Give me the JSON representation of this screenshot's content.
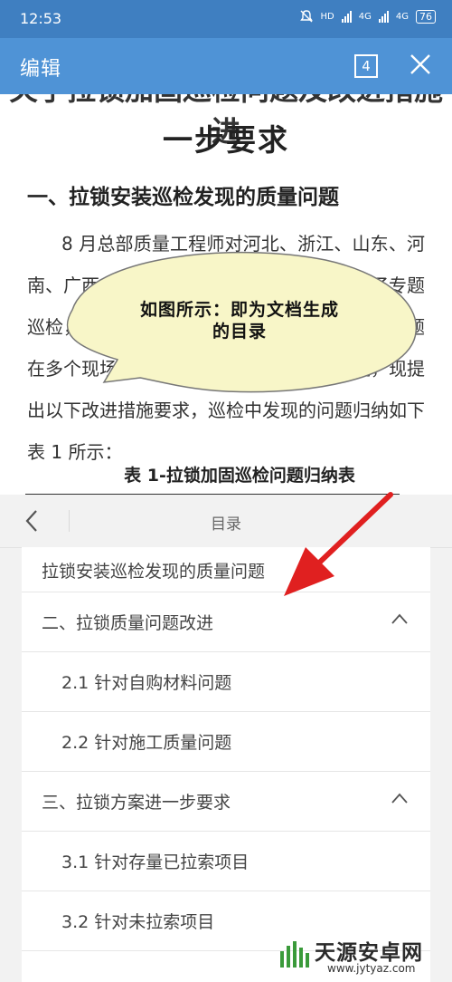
{
  "status_bar": {
    "time": "12:53",
    "net1": "4G",
    "net1_sub": "HD",
    "net2": "4G",
    "battery": "76"
  },
  "titlebar": {
    "title": "编辑",
    "tab_count": "4"
  },
  "document": {
    "heading_cut": "关于拉锁加固巡检问题及改进措施进",
    "heading_line2": "一步要求",
    "section1": "一、拉锁安装巡检发现的质量问题",
    "paragraph": "8 月总部质量工程师对河北、浙江、山东、河南、广西、安徽等地区的拉锁加固项目进行了专题巡检，发现了一些较为突出的质量问题，部分问题在多个现场项目中反复出现。针对以上问题，现提出以下改进措施要求，巡检中发现的问题归纳如下表 1 所示：",
    "table_caption": "表 1-拉锁加固巡检问题归纳表"
  },
  "annotation": {
    "line1": "如图所示：即为文档生成",
    "line2": "的目录"
  },
  "toc": {
    "title": "目录",
    "items": [
      {
        "label": "拉锁安装巡检发现的质量问题"
      },
      {
        "label": "二、拉锁质量问题改进"
      },
      {
        "label": "2.1 针对自购材料问题"
      },
      {
        "label": "2.2 针对施工质量问题"
      },
      {
        "label": "三、拉锁方案进一步要求"
      },
      {
        "label": "3.1 针对存量已拉索项目"
      },
      {
        "label": "3.2 针对未拉索项目"
      }
    ]
  },
  "watermark": {
    "name": "天源安卓网",
    "url": "www.jytyaz.com"
  },
  "colors": {
    "status_bar": "#3f7fc1",
    "title_bar": "#4f93d6",
    "bubble_fill": "#f8f6c8",
    "arrow": "#e02020"
  }
}
